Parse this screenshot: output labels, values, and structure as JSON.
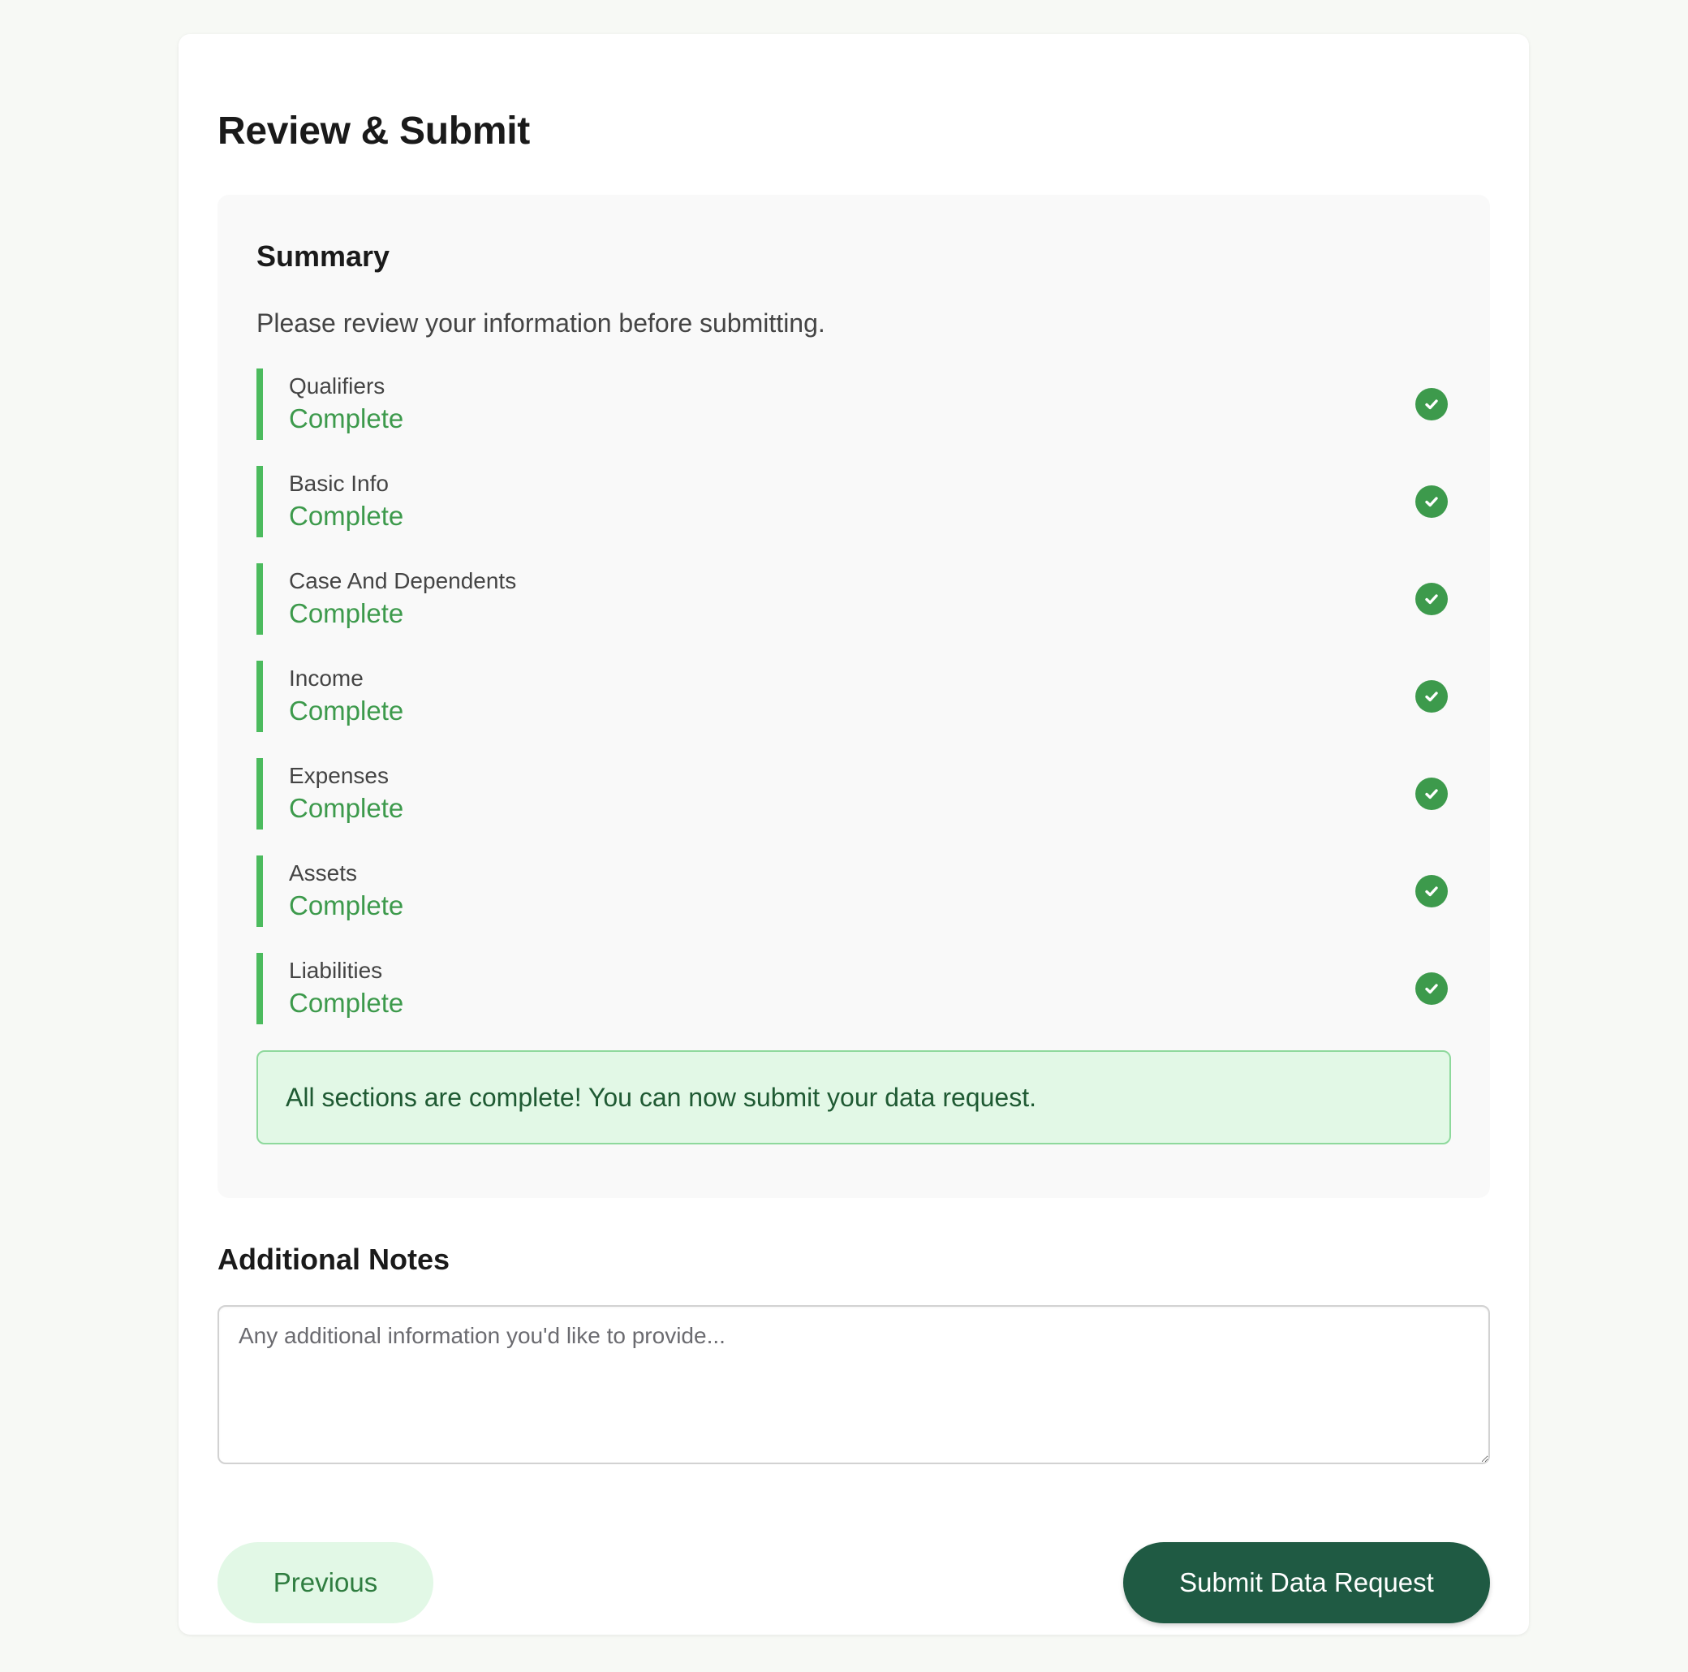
{
  "page": {
    "title": "Review & Submit"
  },
  "summary": {
    "title": "Summary",
    "description": "Please review your information before submitting.",
    "sections": [
      {
        "name": "Qualifiers",
        "status": "Complete",
        "icon": "check-circle-icon"
      },
      {
        "name": "Basic Info",
        "status": "Complete",
        "icon": "check-circle-icon"
      },
      {
        "name": "Case And Dependents",
        "status": "Complete",
        "icon": "check-circle-icon"
      },
      {
        "name": "Income",
        "status": "Complete",
        "icon": "check-circle-icon"
      },
      {
        "name": "Expenses",
        "status": "Complete",
        "icon": "check-circle-icon"
      },
      {
        "name": "Assets",
        "status": "Complete",
        "icon": "check-circle-icon"
      },
      {
        "name": "Liabilities",
        "status": "Complete",
        "icon": "check-circle-icon"
      }
    ],
    "complete_message": "All sections are complete! You can now submit your data request."
  },
  "notes": {
    "title": "Additional Notes",
    "placeholder": "Any additional information you'd like to provide...",
    "value": ""
  },
  "actions": {
    "previous_label": "Previous",
    "submit_label": "Submit Data Request"
  },
  "colors": {
    "accent": "#4cbb5e",
    "status_text": "#3d9a4c",
    "primary_button": "#1f5a43",
    "banner_bg": "#e2f8e6"
  }
}
